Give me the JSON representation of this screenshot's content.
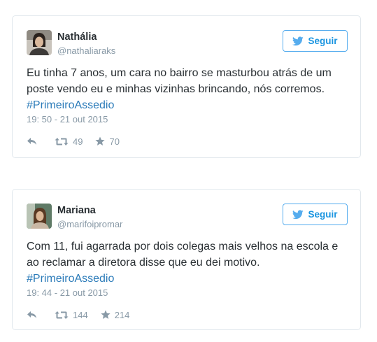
{
  "tweets": [
    {
      "name": "Nathália",
      "handle": "@nathaliaraks",
      "follow_label": "Seguir",
      "text_lines": [
        "Eu tinha 7 anos, um cara no bairro se masturbou atrás de um",
        "poste vendo eu e minhas vizinhas brincando, nós corremos."
      ],
      "hashtag": "#PrimeiroAssedio",
      "timestamp": "19: 50 - 21 out 2015",
      "retweets": "49",
      "likes": "70"
    },
    {
      "name": "Mariana",
      "handle": "@marifoipromar",
      "follow_label": "Seguir",
      "text_lines": [
        "Com 11, fui agarrada por dois colegas mais velhos na escola e",
        "ao reclamar a diretora disse que eu dei motivo."
      ],
      "hashtag": "#PrimeiroAssedio",
      "timestamp": "19: 44 - 21 out 2015",
      "retweets": "144",
      "likes": "214"
    }
  ],
  "colors": {
    "accent": "#55acee",
    "link": "#2b7bb9",
    "muted": "#8899a6",
    "border": "#e1e8ed",
    "text": "#292f33"
  },
  "icons": {
    "follow": "twitter-bird-icon",
    "reply": "reply-icon",
    "retweet": "retweet-icon",
    "like": "star-icon"
  }
}
